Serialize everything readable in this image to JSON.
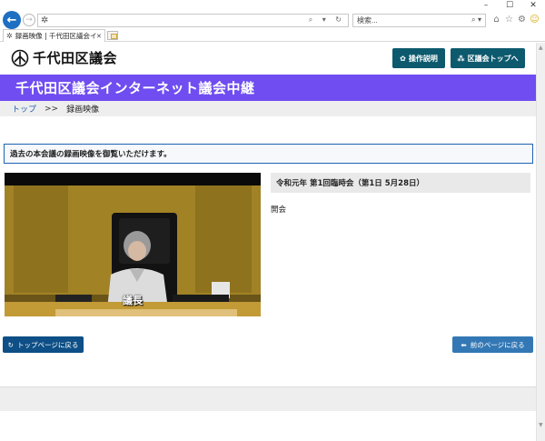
{
  "browser": {
    "window_controls": {
      "minimize": "–",
      "maximize": "☐",
      "close": "✕"
    },
    "address": {
      "value": "",
      "right_icons": "⌕ ▾ ↻"
    },
    "search": {
      "placeholder": "検索...",
      "right_icons": "⌕ ▾"
    },
    "tab": {
      "title": "録画映像 | 千代田区議会イ...",
      "close": "✕"
    },
    "tool_icons": {
      "home": "⌂",
      "favorites": "☆",
      "settings": "⚙",
      "feedback": "☺"
    }
  },
  "header": {
    "site_name": "千代田区議会",
    "manual_button": "操作説明",
    "top_button": "区議会トップへ"
  },
  "banner": {
    "title": "千代田区議会インターネット議会中継"
  },
  "breadcrumb": {
    "home": "トップ",
    "separator": ">>",
    "current": "録画映像"
  },
  "notice": "過去の本会議の録画映像を御覧いただけます。",
  "video": {
    "caption": "議長"
  },
  "session": {
    "title": "令和元年 第1回臨時会（第1日 5月28日）",
    "agenda_item": "開会"
  },
  "footer_buttons": {
    "back_to_top": "トップページに戻る",
    "back_prev": "前のページに戻る"
  },
  "colors": {
    "banner": "#6f4df0",
    "header_button": "#0d5a6e",
    "notice_border": "#1f63b1",
    "back_top_button": "#0d4f86",
    "back_prev_button": "#3378b5"
  }
}
